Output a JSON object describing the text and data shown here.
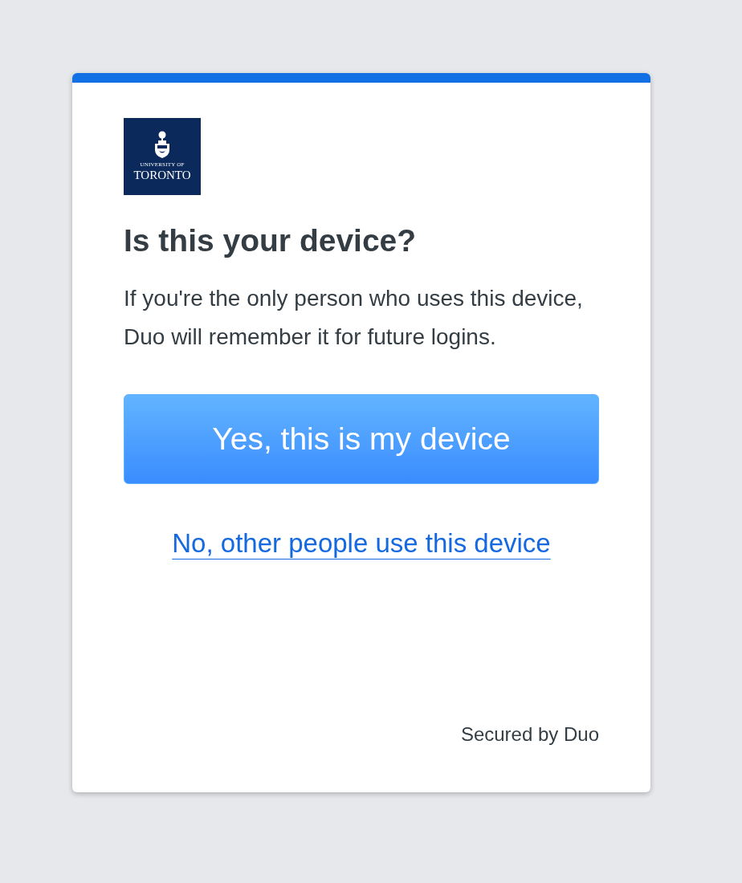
{
  "logo": {
    "lines": [
      "UNIVERSITY OF",
      "TORONTO"
    ]
  },
  "title": "Is this your device?",
  "description": "If you're the only person who uses this device, Duo will remember it for future logins.",
  "buttons": [
    {
      "kind": "primary",
      "label": "Yes, this is my device"
    },
    {
      "kind": "link",
      "label": "No, other people use this device"
    }
  ],
  "footer": "Secured by Duo"
}
